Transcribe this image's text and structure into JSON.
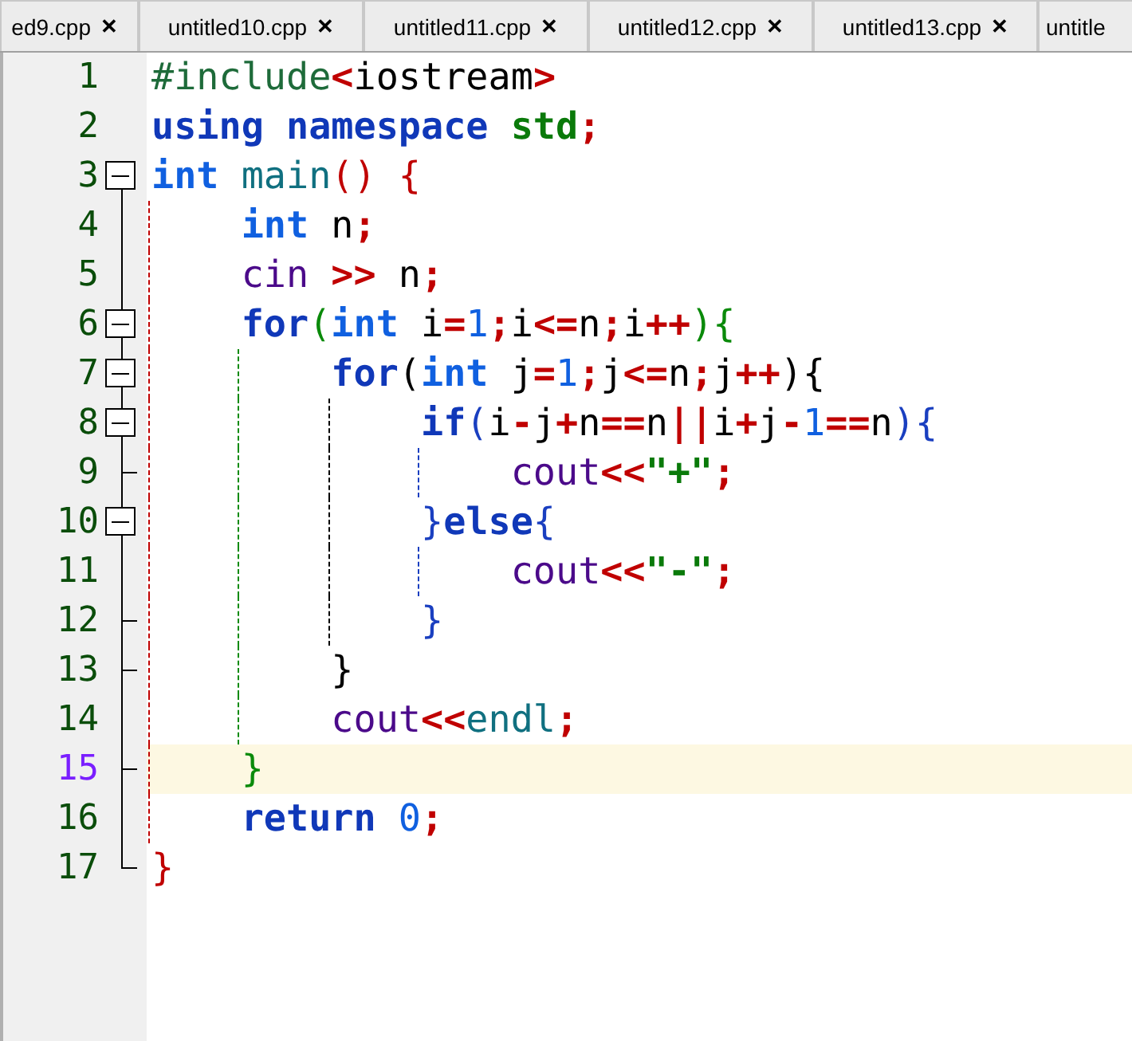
{
  "tabs": [
    {
      "label": "ed9.cpp",
      "close": "✕",
      "selected": false
    },
    {
      "label": "untitled10.cpp",
      "close": "✕",
      "selected": false
    },
    {
      "label": "untitled11.cpp",
      "close": "✕",
      "selected": false
    },
    {
      "label": "untitled12.cpp",
      "close": "✕",
      "selected": false
    },
    {
      "label": "untitled13.cpp",
      "close": "✕",
      "selected": false
    },
    {
      "label": "untitle",
      "selected": false
    }
  ],
  "lines": [
    {
      "number": "1",
      "current": false,
      "tokens": [
        {
          "text": "#include",
          "kind": "preproc"
        },
        {
          "text": "<",
          "kind": "op"
        },
        {
          "text": "iostream",
          "kind": "ident"
        },
        {
          "text": ">",
          "kind": "op"
        }
      ]
    },
    {
      "number": "2",
      "current": false,
      "tokens": [
        {
          "text": "using namespace",
          "kind": "keyword"
        },
        {
          "text": " std",
          "kind": "string"
        },
        {
          "text": ";",
          "kind": "op"
        }
      ]
    },
    {
      "number": "3",
      "current": false,
      "fold": {
        "kind": "box"
      },
      "tokens": [
        {
          "text": "int",
          "kind": "type"
        },
        {
          "text": " main",
          "kind": "func"
        },
        {
          "text": "()",
          "kind": "level1"
        },
        {
          "text": " {",
          "kind": "level1"
        }
      ]
    },
    {
      "number": "4",
      "current": false,
      "fold": {
        "kind": "line"
      },
      "guides": [
        {
          "kind": "level1"
        }
      ],
      "tokens": [
        {
          "text": "    int",
          "kind": "type"
        },
        {
          "text": " n",
          "kind": "ident"
        },
        {
          "text": ";",
          "kind": "op"
        }
      ]
    },
    {
      "number": "5",
      "current": false,
      "fold": {
        "kind": "line"
      },
      "guides": [
        {
          "kind": "level1"
        }
      ],
      "tokens": [
        {
          "text": "    cin",
          "kind": "stream"
        },
        {
          "text": " >>",
          "kind": "op"
        },
        {
          "text": " n",
          "kind": "ident"
        },
        {
          "text": ";",
          "kind": "op"
        }
      ]
    },
    {
      "number": "6",
      "current": false,
      "fold": {
        "kind": "box"
      },
      "guides": [
        {
          "kind": "level1"
        }
      ],
      "tokens": [
        {
          "text": "    for",
          "kind": "keyword"
        },
        {
          "text": "(",
          "kind": "level2"
        },
        {
          "text": "int",
          "kind": "type"
        },
        {
          "text": " i",
          "kind": "ident"
        },
        {
          "text": "=",
          "kind": "op"
        },
        {
          "text": "1",
          "kind": "number"
        },
        {
          "text": ";",
          "kind": "op"
        },
        {
          "text": "i",
          "kind": "ident"
        },
        {
          "text": "<=",
          "kind": "op"
        },
        {
          "text": "n",
          "kind": "ident"
        },
        {
          "text": ";",
          "kind": "op"
        },
        {
          "text": "i",
          "kind": "ident"
        },
        {
          "text": "++",
          "kind": "op"
        },
        {
          "text": "){",
          "kind": "level2"
        }
      ]
    },
    {
      "number": "7",
      "current": false,
      "fold": {
        "kind": "box"
      },
      "guides": [
        {
          "kind": "level1"
        },
        {
          "kind": "level2"
        }
      ],
      "tokens": [
        {
          "text": "        for",
          "kind": "keyword"
        },
        {
          "text": "(",
          "kind": "level3"
        },
        {
          "text": "int",
          "kind": "type"
        },
        {
          "text": " j",
          "kind": "ident"
        },
        {
          "text": "=",
          "kind": "op"
        },
        {
          "text": "1",
          "kind": "number"
        },
        {
          "text": ";",
          "kind": "op"
        },
        {
          "text": "j",
          "kind": "ident"
        },
        {
          "text": "<=",
          "kind": "op"
        },
        {
          "text": "n",
          "kind": "ident"
        },
        {
          "text": ";",
          "kind": "op"
        },
        {
          "text": "j",
          "kind": "ident"
        },
        {
          "text": "++",
          "kind": "op"
        },
        {
          "text": "){",
          "kind": "level3"
        }
      ]
    },
    {
      "number": "8",
      "current": false,
      "fold": {
        "kind": "box"
      },
      "guides": [
        {
          "kind": "level1"
        },
        {
          "kind": "level2"
        },
        {
          "kind": "level3"
        }
      ],
      "tokens": [
        {
          "text": "            if",
          "kind": "keyword"
        },
        {
          "text": "(",
          "kind": "level4"
        },
        {
          "text": "i",
          "kind": "ident"
        },
        {
          "text": "-",
          "kind": "op"
        },
        {
          "text": "j",
          "kind": "ident"
        },
        {
          "text": "+",
          "kind": "op"
        },
        {
          "text": "n",
          "kind": "ident"
        },
        {
          "text": "==",
          "kind": "op"
        },
        {
          "text": "n",
          "kind": "ident"
        },
        {
          "text": "||",
          "kind": "op"
        },
        {
          "text": "i",
          "kind": "ident"
        },
        {
          "text": "+",
          "kind": "op"
        },
        {
          "text": "j",
          "kind": "ident"
        },
        {
          "text": "-",
          "kind": "op"
        },
        {
          "text": "1",
          "kind": "number"
        },
        {
          "text": "==",
          "kind": "op"
        },
        {
          "text": "n",
          "kind": "ident"
        },
        {
          "text": "){",
          "kind": "level4"
        }
      ]
    },
    {
      "number": "9",
      "current": false,
      "fold": {
        "kind": "tick"
      },
      "guides": [
        {
          "kind": "level1"
        },
        {
          "kind": "level2"
        },
        {
          "kind": "level3"
        },
        {
          "kind": "level4"
        }
      ],
      "tokens": [
        {
          "text": "                cout",
          "kind": "stream"
        },
        {
          "text": "<<",
          "kind": "op"
        },
        {
          "text": "\"+\"",
          "kind": "string"
        },
        {
          "text": ";",
          "kind": "op"
        }
      ]
    },
    {
      "number": "10",
      "current": false,
      "fold": {
        "kind": "box"
      },
      "guides": [
        {
          "kind": "level1"
        },
        {
          "kind": "level2"
        },
        {
          "kind": "level3"
        }
      ],
      "tokens": [
        {
          "text": "            }",
          "kind": "level4"
        },
        {
          "text": "else",
          "kind": "keyword"
        },
        {
          "text": "{",
          "kind": "level4"
        }
      ]
    },
    {
      "number": "11",
      "current": false,
      "fold": {
        "kind": "line"
      },
      "guides": [
        {
          "kind": "level1"
        },
        {
          "kind": "level2"
        },
        {
          "kind": "level3"
        },
        {
          "kind": "level4"
        }
      ],
      "tokens": [
        {
          "text": "                cout",
          "kind": "stream"
        },
        {
          "text": "<<",
          "kind": "op"
        },
        {
          "text": "\"-\"",
          "kind": "string"
        },
        {
          "text": ";",
          "kind": "op"
        }
      ]
    },
    {
      "number": "12",
      "current": false,
      "fold": {
        "kind": "tick"
      },
      "guides": [
        {
          "kind": "level1"
        },
        {
          "kind": "level2"
        },
        {
          "kind": "level3"
        }
      ],
      "tokens": [
        {
          "text": "            }",
          "kind": "level4"
        }
      ]
    },
    {
      "number": "13",
      "current": false,
      "fold": {
        "kind": "tick"
      },
      "guides": [
        {
          "kind": "level1"
        },
        {
          "kind": "level2"
        }
      ],
      "tokens": [
        {
          "text": "        }",
          "kind": "level3"
        }
      ]
    },
    {
      "number": "14",
      "current": false,
      "fold": {
        "kind": "line"
      },
      "guides": [
        {
          "kind": "level1"
        },
        {
          "kind": "level2"
        }
      ],
      "tokens": [
        {
          "text": "        cout",
          "kind": "stream"
        },
        {
          "text": "<<",
          "kind": "op"
        },
        {
          "text": "endl",
          "kind": "func"
        },
        {
          "text": ";",
          "kind": "op"
        }
      ]
    },
    {
      "number": "15",
      "current": true,
      "fold": {
        "kind": "tick"
      },
      "guides": [
        {
          "kind": "level1"
        }
      ],
      "tokens": [
        {
          "text": "    }",
          "kind": "level2"
        }
      ]
    },
    {
      "number": "16",
      "current": false,
      "fold": {
        "kind": "line"
      },
      "guides": [
        {
          "kind": "level1"
        }
      ],
      "tokens": [
        {
          "text": "    return",
          "kind": "keyword"
        },
        {
          "text": " 0",
          "kind": "number"
        },
        {
          "text": ";",
          "kind": "op"
        }
      ]
    },
    {
      "number": "17",
      "current": false,
      "fold": {
        "kind": "end"
      },
      "tokens": [
        {
          "text": "}",
          "kind": "level1"
        }
      ]
    }
  ]
}
